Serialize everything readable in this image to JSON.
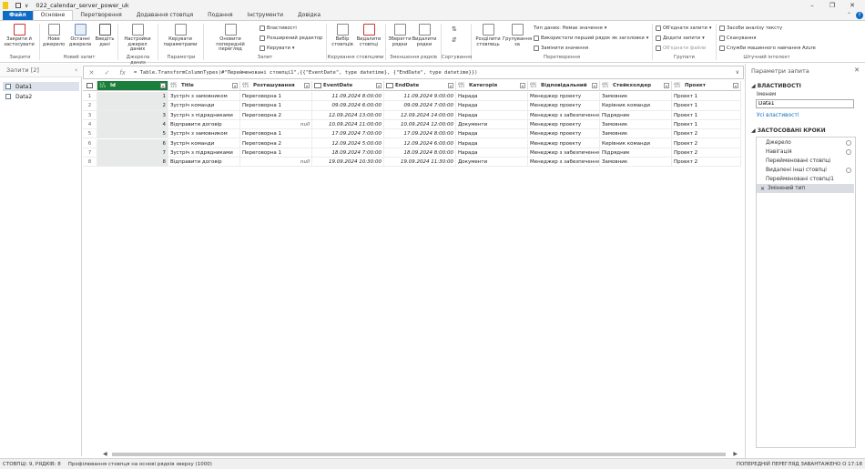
{
  "window": {
    "title": "022_calendar_server_power_uk",
    "minimize": "–",
    "maximize": "❐",
    "close": "✕"
  },
  "tabs": [
    "Файл",
    "Основне",
    "Перетворення",
    "Додавання стовпця",
    "Подання",
    "Інструменти",
    "Довідка"
  ],
  "ribbon": {
    "close_apply": "Закрити й застосувати",
    "new_source": "Нове джерело",
    "recent_sources": "Останні джерела",
    "enter_data": "Введіть дані",
    "ds_settings": "Настройки джерел даних",
    "manage_params": "Керувати параметрами",
    "refresh_preview": "Оновити попередній перегляд",
    "properties": "Властивості",
    "advanced_editor": "Розширений редактор",
    "manage": "Керувати",
    "choose_columns": "Вибір стовпців",
    "remove_columns": "Видалити стовпці",
    "keep_rows": "Зберегти рядки",
    "remove_rows": "Видалити рядки",
    "split_column": "Розділити стовпець",
    "group_by": "Групування за",
    "data_type": "Тип даних: Немає значення",
    "first_row_headers": "Використати перший рядок як заголовки",
    "replace_values": "Замінити значення",
    "merge_queries": "Об'єднати запити",
    "append_queries": "Додати запити",
    "combine_files": "Об'єднати файли",
    "text_analytics": "Засоби аналізу тексту",
    "vision": "Сканування",
    "azure_ml": "Служби машинного навчання Azure",
    "groups": [
      "Закрити",
      "Новий запит",
      "Джерела даних",
      "Параметри",
      "Запит",
      "Керування стовпцями",
      "Зменшення рядків",
      "Сортування",
      "Перетворення",
      "Групати",
      "Штучний інтелект"
    ]
  },
  "queries": {
    "header": "Запити [2]",
    "items": [
      "Data1",
      "Data2"
    ]
  },
  "formula": "= Table.TransformColumnTypes(#\"Перейменовані стовпці1\",{{\"EventDate\", type datetime}, {\"EndDate\", type datetime}})",
  "columns": [
    {
      "type": "1.2\n123",
      "name": "Id"
    },
    {
      "type": "ABC\n123",
      "name": "Title"
    },
    {
      "type": "ABC\n123",
      "name": "Розташування"
    },
    {
      "type": "",
      "name": "EventDate"
    },
    {
      "type": "",
      "name": "EndDate"
    },
    {
      "type": "ABC\n123",
      "name": "Категорія"
    },
    {
      "type": "ABC\n123",
      "name": "Відповідальний"
    },
    {
      "type": "ABC\n123",
      "name": "Стейкхолдер"
    },
    {
      "type": "ABC\n123",
      "name": "Проект"
    }
  ],
  "rows": [
    [
      "1",
      "1",
      "Зустріч з замовником",
      "Переговорна 1",
      "11.09.2024 8:00:00",
      "11.09.2024 9:00:00",
      "Нарада",
      "Менеджер проекту",
      "Замовник",
      "Проект 1"
    ],
    [
      "2",
      "2",
      "Зустріч команди",
      "Переговорна 1",
      "09.09.2024 6:00:00",
      "09.09.2024 7:00:00",
      "Нарада",
      "Менеджер проекту",
      "Керівник команди",
      "Проект 1"
    ],
    [
      "3",
      "3",
      "Зустріч з підрядниками",
      "Переговорна 2",
      "12.09.2024 13:00:00",
      "12.09.2024 14:00:00",
      "Нарада",
      "Менеджер з забезпечення",
      "Підрядник",
      "Проект 1"
    ],
    [
      "4",
      "4",
      "Відправити договір",
      "null",
      "10.09.2024 11:00:00",
      "10.09.2024 12:00:00",
      "Документи",
      "Менеджер проекту",
      "Замовник",
      "Проект 1"
    ],
    [
      "5",
      "5",
      "Зустріч з замовником",
      "Переговорна 1",
      "17.09.2024 7:00:00",
      "17.09.2024 8:00:00",
      "Нарада",
      "Менеджер проекту",
      "Замовник",
      "Проект 2"
    ],
    [
      "6",
      "6",
      "Зустріч команди",
      "Переговорна 2",
      "12.09.2024 5:00:00",
      "12.09.2024 6:00:00",
      "Нарада",
      "Менеджер проекту",
      "Керівник команди",
      "Проект 2"
    ],
    [
      "7",
      "7",
      "Зустріч з підрядниками",
      "Переговорна 1",
      "18.09.2024 7:00:00",
      "18.09.2024 8:00:00",
      "Нарада",
      "Менеджер з забезпечення",
      "Підрядник",
      "Проект 2"
    ],
    [
      "8",
      "8",
      "Відправити договір",
      "null",
      "19.09.2024 10:30:00",
      "19.09.2024 11:30:00",
      "Документи",
      "Менеджер з забезпечення",
      "Замовник",
      "Проект 2"
    ]
  ],
  "settings": {
    "title": "Параметри запита",
    "properties_header": "ВЛАСТИВОСТІ",
    "name_label": "Іменем",
    "name_value": "Data1",
    "all_properties": "Усі властивості",
    "steps_header": "ЗАСТОСОВАНІ КРОКИ",
    "steps": [
      "Джерело",
      "Навігація",
      "Перейменовані стовпці",
      "Видалені інші стовпці",
      "Перейменовані стовпці1",
      "Змінений тип"
    ]
  },
  "status": {
    "left": "СТОВПЦІ: 9, РЯДКІВ: 8",
    "middle": "Профілювання стовпця на основі рядків зверху (1000)",
    "right": "ПОПЕРЕДНІЙ ПЕРЕГЛЯД ЗАВАНТАЖЕНО О 17:18"
  },
  "colors": {
    "accent": "#0e6cc4",
    "selected_header": "#1c7e3c"
  }
}
